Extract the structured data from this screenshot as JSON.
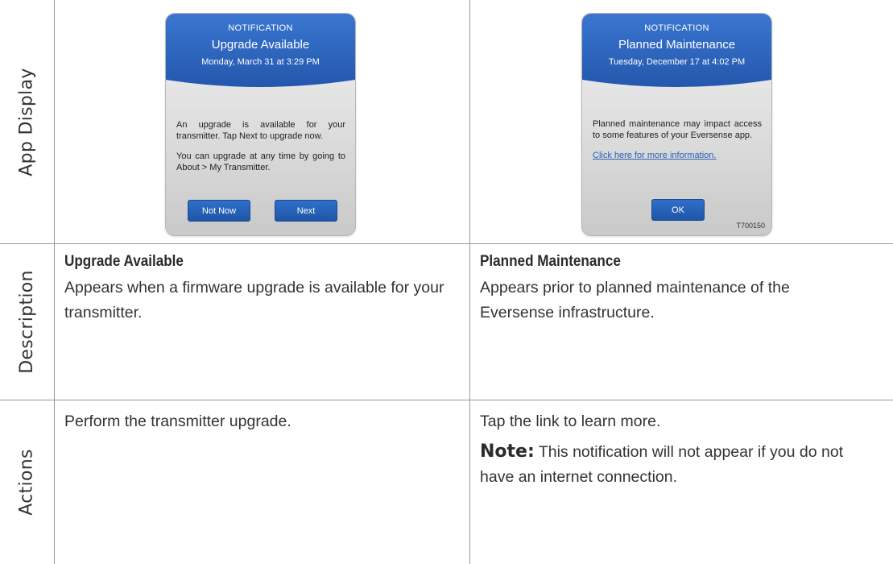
{
  "rows": {
    "app_display": "App Display",
    "description": "Description",
    "actions": "Actions"
  },
  "left": {
    "card": {
      "kicker": "NOTIFICATION",
      "title": "Upgrade Available",
      "date": "Monday, March 31 at 3:29 PM",
      "para1": "An upgrade is available for your transmitter. Tap Next to upgrade now.",
      "para2": "You can upgrade at any time by going to About > My Transmitter.",
      "button1": "Not Now",
      "button2": "Next"
    },
    "desc_title": "Upgrade Available",
    "desc_text": "Appears when a firmware upgrade is available for your transmitter.",
    "action_text": "Perform the transmitter upgrade."
  },
  "right": {
    "card": {
      "kicker": "NOTIFICATION",
      "title": "Planned Maintenance",
      "date": "Tuesday, December 17 at 4:02 PM",
      "para1": "Planned maintenance may impact access to some features of your Eversense app.",
      "link": "Click here for more information.",
      "button": "OK",
      "code": "T700150"
    },
    "desc_title": "Planned Maintenance",
    "desc_text": "Appears prior to planned maintenance of the Eversense infrastructure.",
    "action_text": "Tap the link to learn more.",
    "note_label": "Note:",
    "note_text": " This notification will not appear if you do not have an internet connection."
  },
  "colors": {
    "header_blue": "#2d66c0",
    "button_blue": "#2a64bd",
    "link_blue": "#2a62b8"
  }
}
